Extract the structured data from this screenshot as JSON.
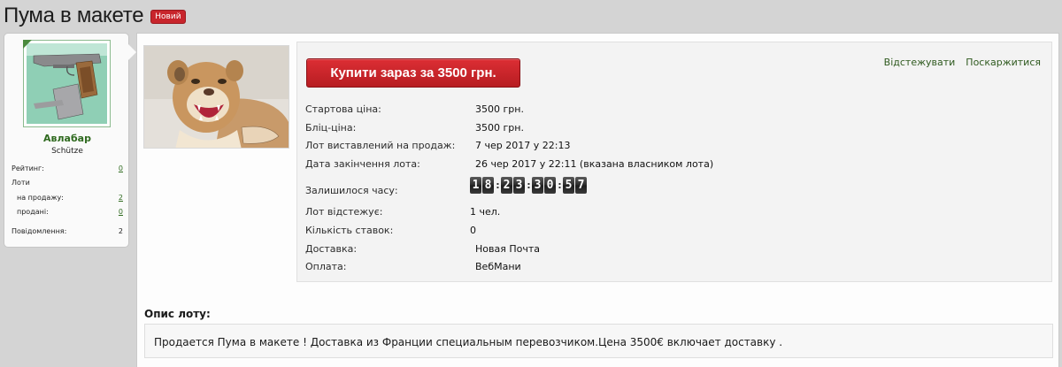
{
  "page": {
    "title": "Пума в макете",
    "badge": "Новий"
  },
  "seller": {
    "username": "Авлабар",
    "usertitle": "Schütze",
    "stats": [
      {
        "label": "Рейтинг:",
        "value": "0",
        "link": true
      },
      {
        "label": "Лоти",
        "value": "",
        "link": false
      },
      {
        "label": "на продажу:",
        "value": "2",
        "link": true
      },
      {
        "label": "продані:",
        "value": "0",
        "link": true
      },
      {
        "label": "Повідомлення:",
        "value": "2",
        "link": false
      }
    ]
  },
  "lot": {
    "buy_button": "Купити зараз за 3500 грн.",
    "links": {
      "watch": "Відстежувати",
      "report": "Поскаржитися"
    },
    "fields": {
      "start_price_label": "Стартова ціна:",
      "start_price": "3500 грн.",
      "blitz_price_label": "Бліц-ціна:",
      "blitz_price": "3500 грн.",
      "listed_label": "Лот виставлений на продаж:",
      "listed": "7 чер 2017 у 22:13",
      "end_label": "Дата закінчення лота:",
      "end": "26 чер 2017 у 22:11 (вказана власником лота)",
      "time_left_label": "Залишилося часу:",
      "watchers_label": "Лот відстежує:",
      "watchers": "1 чел.",
      "bids_label": "Кількість ставок:",
      "bids": "0",
      "delivery_label": "Доставка:",
      "delivery": "Новая Почта",
      "payment_label": "Оплата:",
      "payment": "ВебМани"
    },
    "countdown": {
      "digits": [
        "1",
        "8",
        "2",
        "3",
        "3",
        "0",
        "5",
        "7"
      ],
      "separator": ":"
    }
  },
  "description": {
    "heading": "Опис лоту:",
    "text": "Продается Пума в макете ! Доставка из Франции специальным перевозчиком.Цена 3500€ включает доставку ."
  },
  "colors": {
    "buy_button": "#c8252c",
    "link_green": "#2f5a1f",
    "badge_red": "#c8252c"
  }
}
